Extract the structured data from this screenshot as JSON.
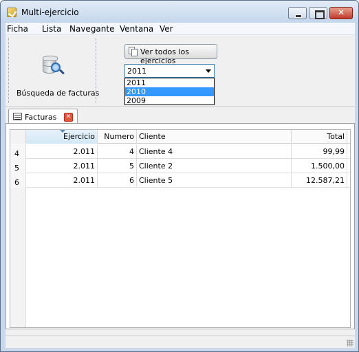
{
  "window": {
    "title": "Multi-ejercicio"
  },
  "menu": [
    "Ficha",
    "Lista",
    "Navegante",
    "Ventana",
    "Ver"
  ],
  "ribbon": {
    "search_label": "Búsqueda de facturas",
    "view_all_label": "Ver todos los ejercicios",
    "year_combo": {
      "selected": "2011",
      "options": [
        "2011",
        "2010",
        "2009"
      ],
      "highlighted": "2010"
    }
  },
  "tab": {
    "label": "Facturas",
    "close_glyph": "✕"
  },
  "grid": {
    "columns": [
      "Ejercicio",
      "Numero",
      "Cliente",
      "Total"
    ],
    "rows": [
      {
        "index": "4",
        "ejercicio": "2.011",
        "numero": "4",
        "cliente": "Cliente 4",
        "total": "99,99"
      },
      {
        "index": "5",
        "ejercicio": "2.011",
        "numero": "5",
        "cliente": "Cliente 2",
        "total": "1.500,00"
      },
      {
        "index": "6",
        "ejercicio": "2.011",
        "numero": "6",
        "cliente": "Cliente 5",
        "total": "12.587,21"
      }
    ]
  },
  "colors": {
    "selection": "#3399ff",
    "titlebar": "#c4d6ec",
    "close_button": "#c0392b"
  }
}
